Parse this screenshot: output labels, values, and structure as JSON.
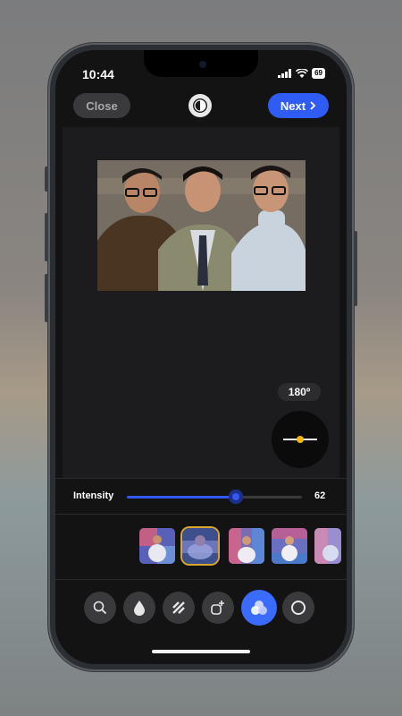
{
  "status_bar": {
    "time": "10:44",
    "battery": "69"
  },
  "topbar": {
    "close_label": "Close",
    "next_label": "Next"
  },
  "rotation": {
    "label": "180º",
    "angle_degrees": 180
  },
  "intensity": {
    "label": "Intensity",
    "value": "62",
    "fraction": 0.62
  },
  "filters": {
    "count_visible": 5,
    "selected_index": 1
  },
  "toolbar": {
    "tools": [
      {
        "icon": "search-icon"
      },
      {
        "icon": "drop-icon"
      },
      {
        "icon": "layers-icon"
      },
      {
        "icon": "add-shape-icon"
      },
      {
        "icon": "filters-icon",
        "active": true
      },
      {
        "icon": "circle-icon"
      }
    ]
  },
  "colors": {
    "accent": "#2f5cf5",
    "selection": "#d7a62c",
    "dial_dot": "#f5b800"
  }
}
